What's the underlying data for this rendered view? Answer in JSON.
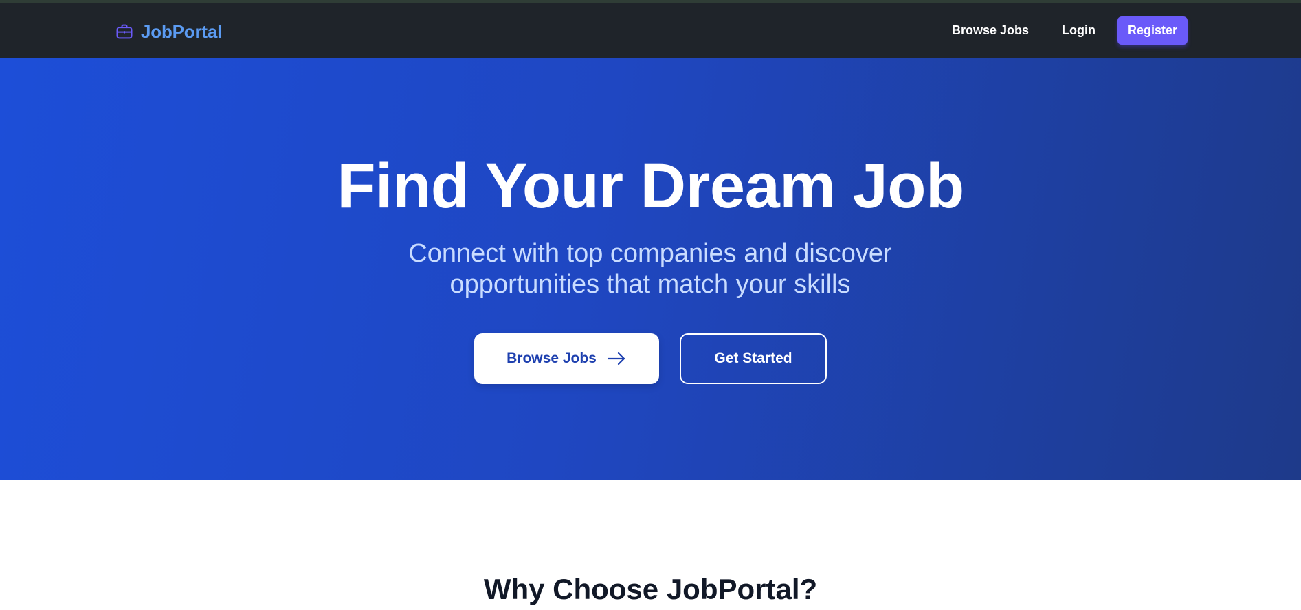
{
  "nav": {
    "brand": "JobPortal",
    "brand_icon": "briefcase-icon",
    "links": {
      "browse_jobs": "Browse Jobs",
      "login": "Login",
      "register": "Register"
    }
  },
  "hero": {
    "title": "Find Your Dream Job",
    "subtitle": "Connect with top companies and discover opportunities that match your skills",
    "primary_button": "Browse Jobs",
    "primary_button_icon": "arrow-right-icon",
    "secondary_button": "Get Started"
  },
  "section": {
    "title": "Why Choose JobPortal?"
  },
  "colors": {
    "navbar_bg": "#1f242a",
    "brand_text": "#5b9bf2",
    "register_button": "#6a5af9",
    "hero_gradient_start": "#1d4ed8",
    "hero_gradient_end": "#1e3a8a",
    "hero_subtitle": "#c9dcff",
    "primary_button_text": "#1e40af"
  }
}
